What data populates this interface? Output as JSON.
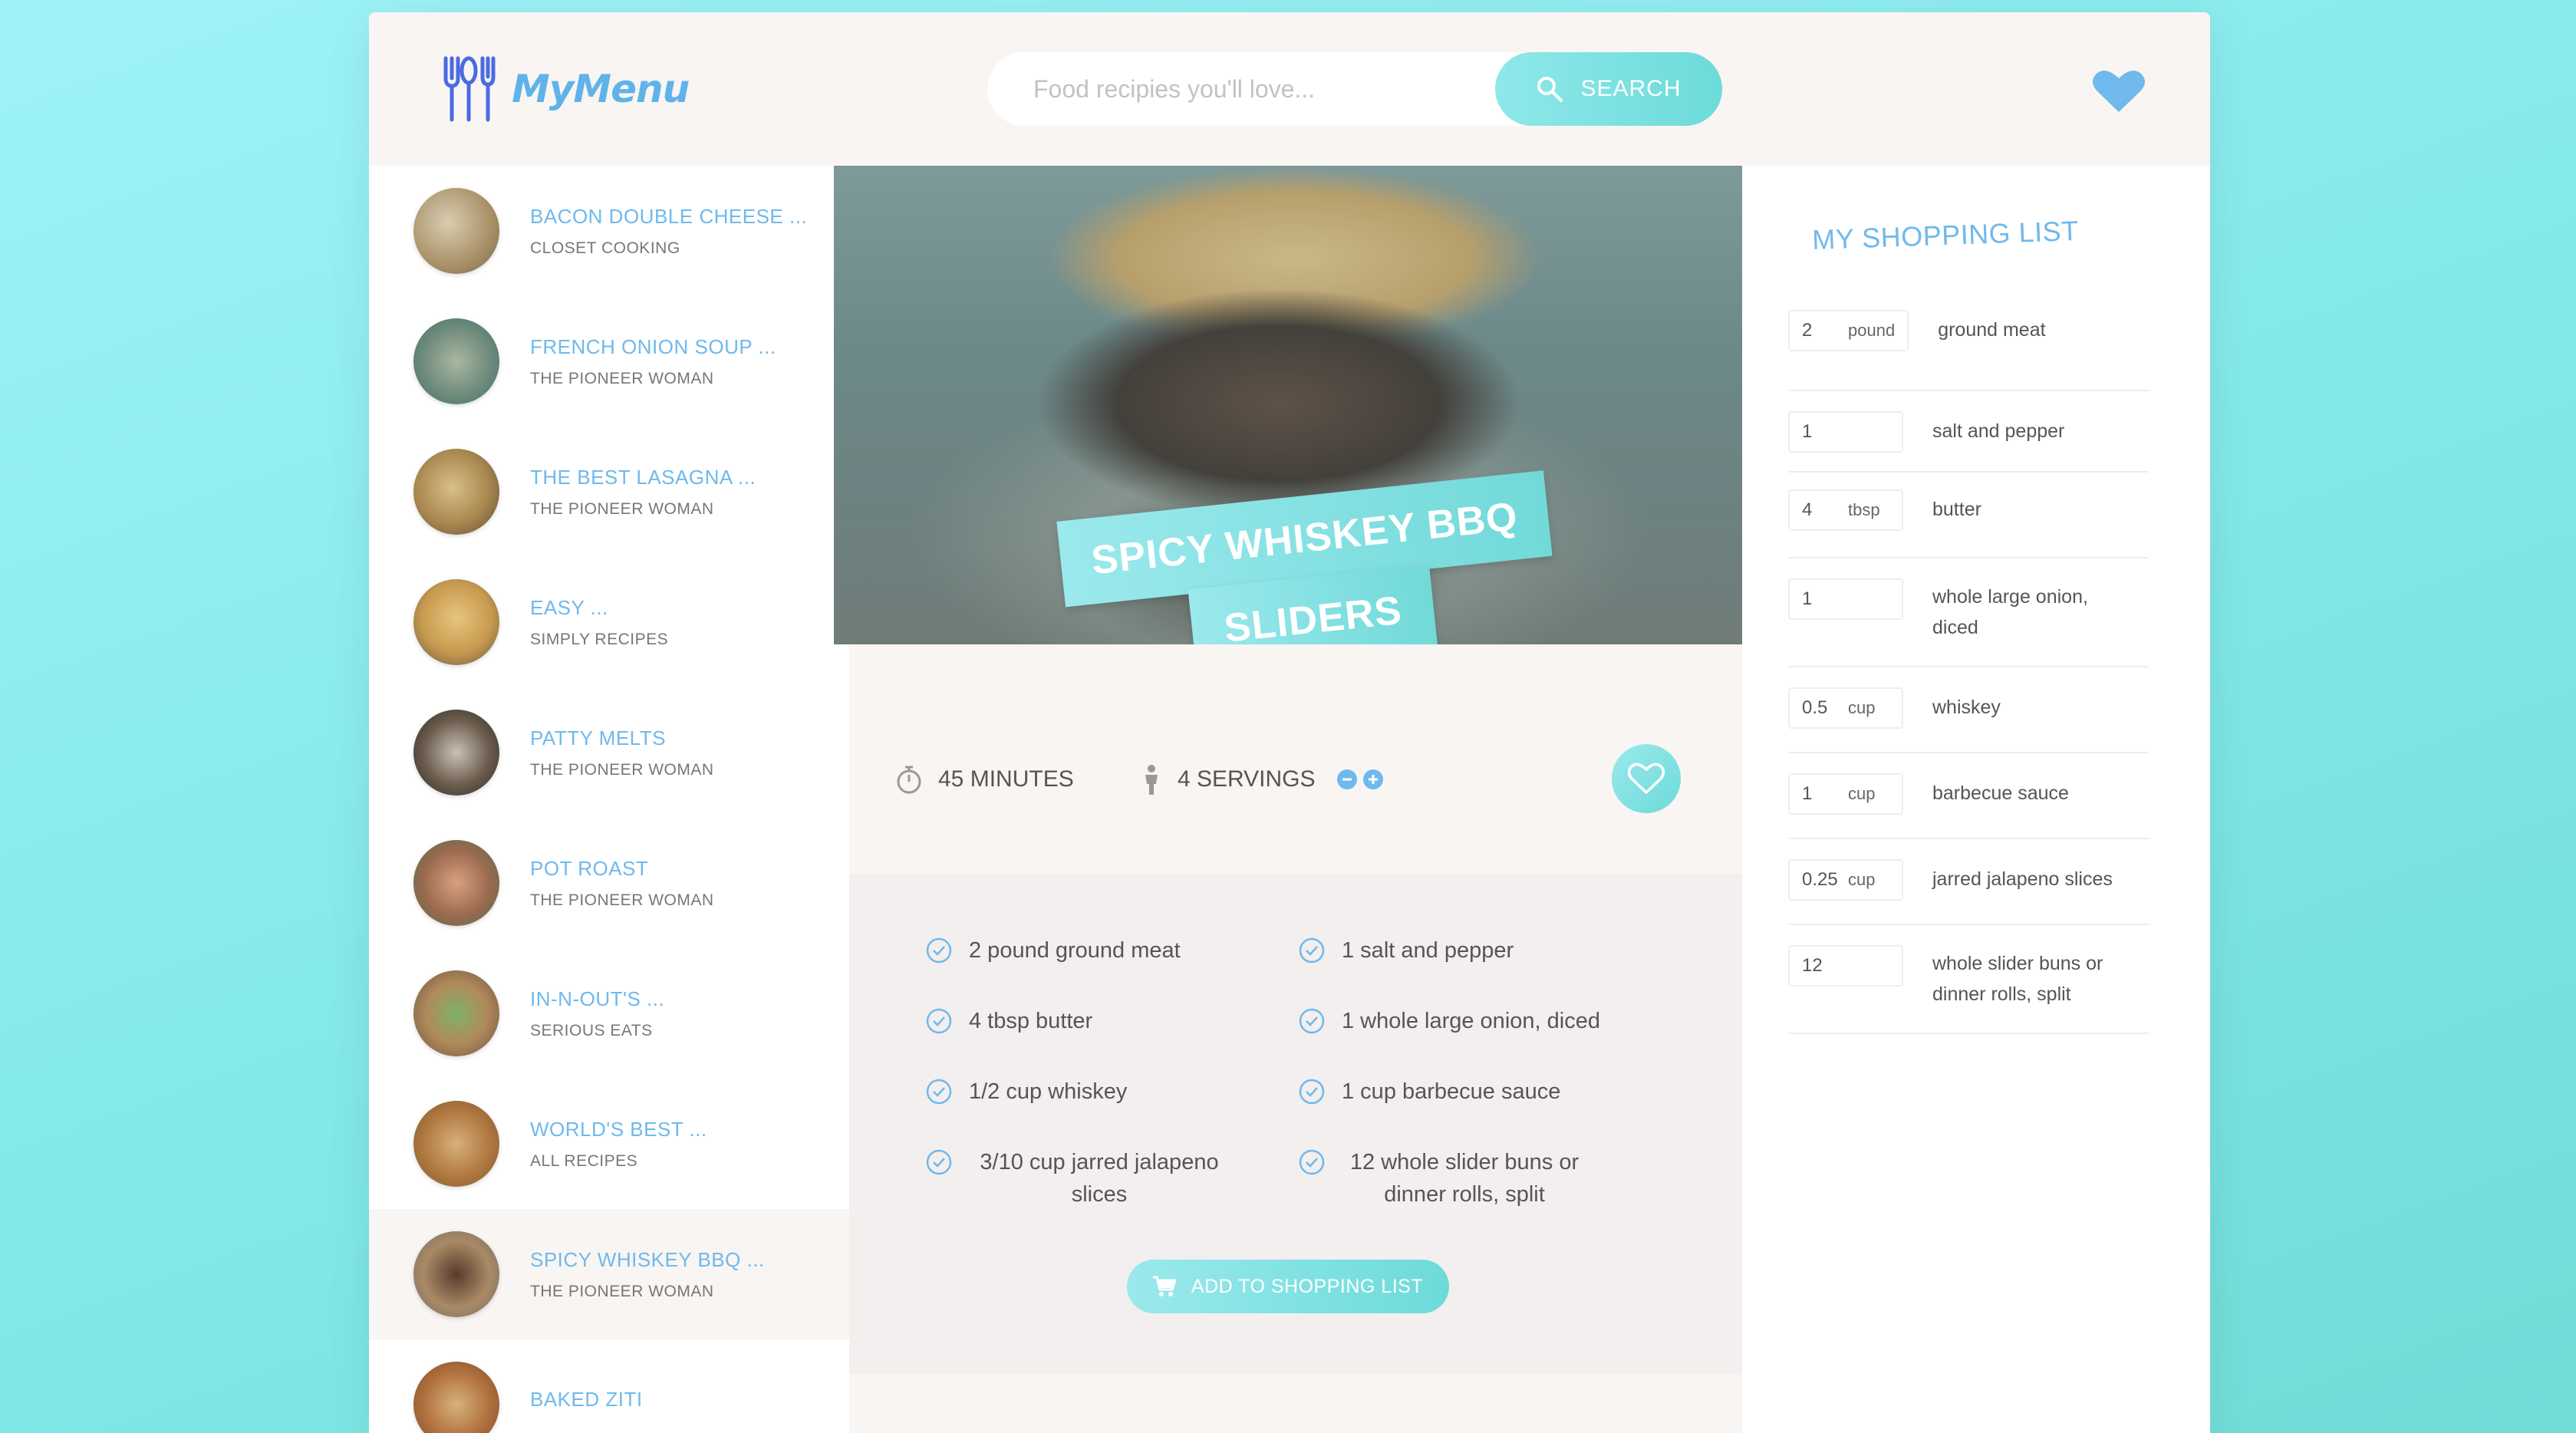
{
  "header": {
    "logo_text": "MyMenu",
    "search_placeholder": "Food recipies you'll love...",
    "search_button": "SEARCH"
  },
  "sidebar": {
    "recipes": [
      {
        "title": "BACON DOUBLE CHEESE ...",
        "publisher": "CLOSET COOKING"
      },
      {
        "title": "FRENCH ONION SOUP ...",
        "publisher": "THE PIONEER WOMAN"
      },
      {
        "title": "THE BEST LASAGNA ...",
        "publisher": "THE PIONEER WOMAN"
      },
      {
        "title": "EASY ...",
        "publisher": "SIMPLY RECIPES"
      },
      {
        "title": "PATTY MELTS",
        "publisher": "THE PIONEER WOMAN"
      },
      {
        "title": "POT ROAST",
        "publisher": "THE PIONEER WOMAN"
      },
      {
        "title": "IN-N-OUT'S ...",
        "publisher": "SERIOUS EATS"
      },
      {
        "title": "WORLD'S BEST ...",
        "publisher": "ALL RECIPES"
      },
      {
        "title": "SPICY WHISKEY BBQ ...",
        "publisher": "THE PIONEER WOMAN"
      },
      {
        "title": "BAKED ZITI",
        "publisher": ""
      }
    ]
  },
  "recipe": {
    "title_line1": "SPICY WHISKEY BBQ",
    "title_line2": "SLIDERS",
    "time": "45",
    "time_unit": "MINUTES",
    "servings": "4",
    "servings_unit": "SERVINGS",
    "ingredients": [
      "2 pound ground meat",
      "1 salt and pepper",
      "4 tbsp butter",
      "1 whole large onion, diced",
      "1/2 cup whiskey",
      "1 cup barbecue sauce",
      "3/10 cup jarred jalapeno slices",
      "12 whole slider buns or dinner rolls, split"
    ],
    "add_button": "ADD TO SHOPPING LIST"
  },
  "shopping": {
    "title": "MY SHOPPING LIST",
    "items": [
      {
        "qty": "2",
        "unit": "pound",
        "desc": "ground meat"
      },
      {
        "qty": "1",
        "unit": "",
        "desc": "salt and pepper"
      },
      {
        "qty": "4",
        "unit": "tbsp",
        "desc": "butter"
      },
      {
        "qty": "1",
        "unit": "",
        "desc": "whole large onion, diced"
      },
      {
        "qty": "0.5",
        "unit": "cup",
        "desc": "whiskey"
      },
      {
        "qty": "1",
        "unit": "cup",
        "desc": "barbecue sauce"
      },
      {
        "qty": "0.25",
        "unit": "cup",
        "desc": "jarred jalapeno slices"
      },
      {
        "qty": "12",
        "unit": "",
        "desc": "whole slider buns or dinner rolls, split"
      }
    ]
  },
  "colors": {
    "accent": "#6fb9ec",
    "teal": "#6cdbd9",
    "background": "#8eeef2"
  }
}
